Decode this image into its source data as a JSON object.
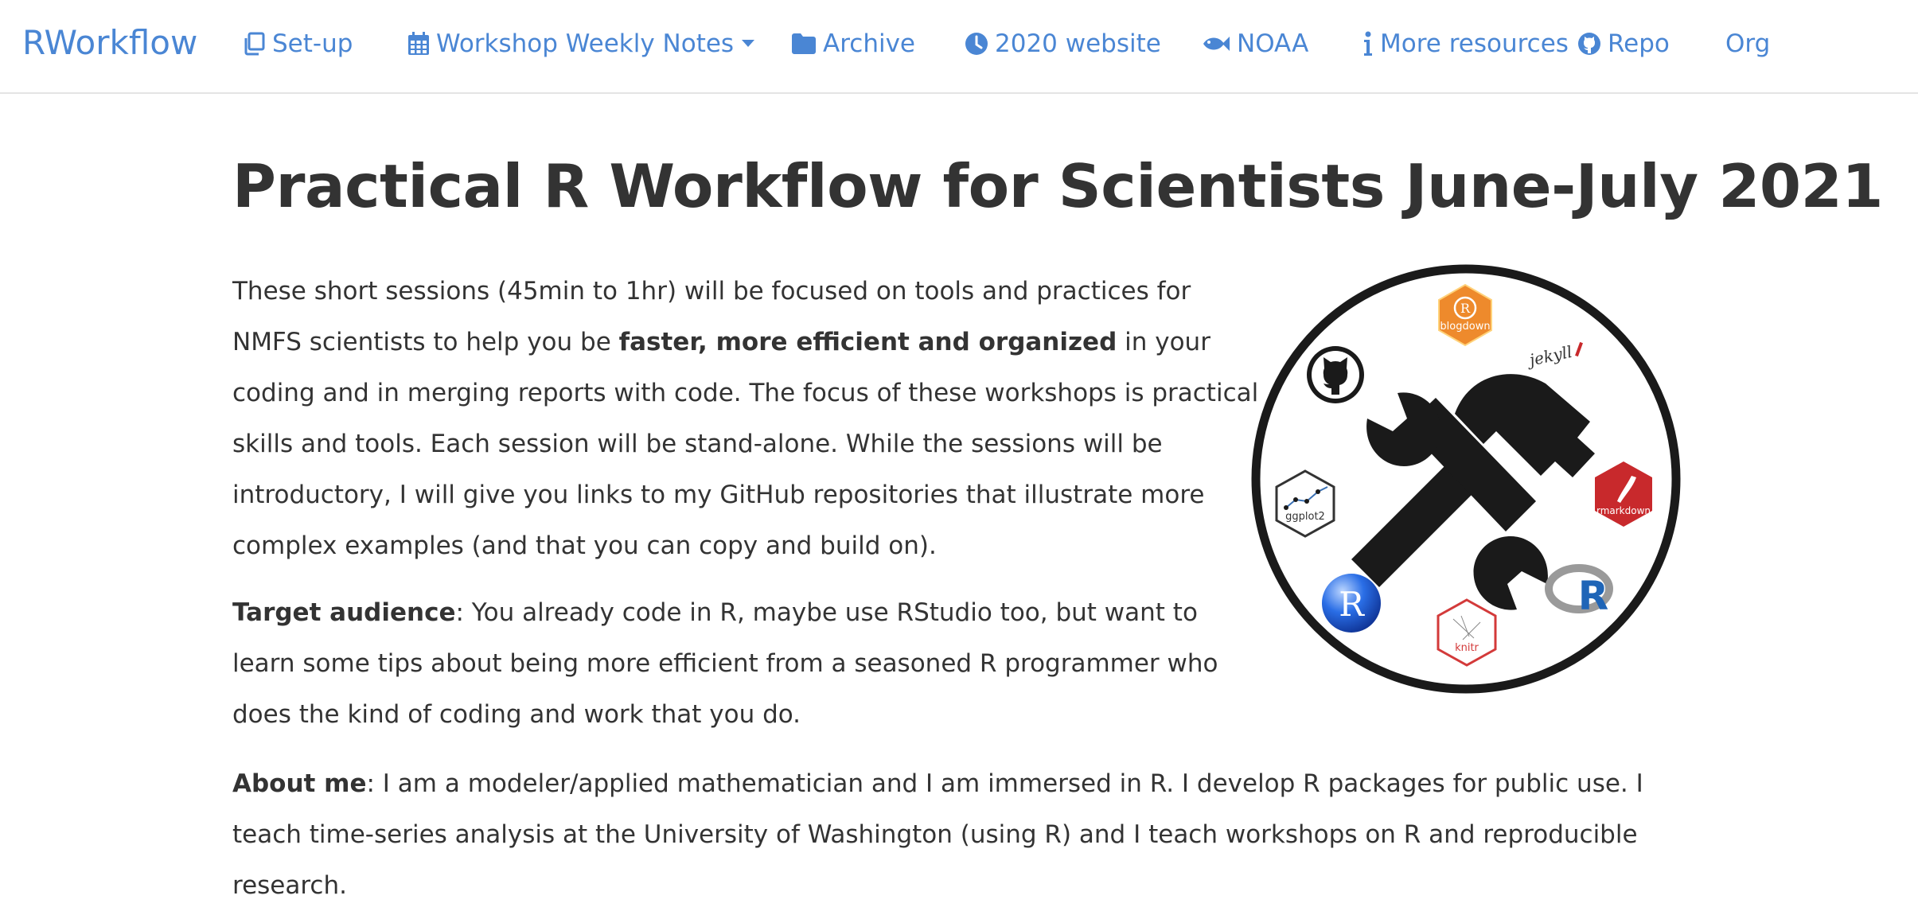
{
  "brand": "RWorkflow",
  "nav": {
    "setup": "Set-up",
    "weekly": "Workshop Weekly Notes",
    "archive": "Archive",
    "website": "2020 website",
    "noaa": "NOAA",
    "resources": "More resources",
    "repo": "Repo",
    "org": "Org"
  },
  "main": {
    "title": "Practical R Workflow for Scientists June-July 2021",
    "intro": {
      "part1": "These short sessions (45min to 1hr) will be focused on tools and practices for NMFS scientists to help you be ",
      "bold": "faster, more efficient and organized",
      "part2": " in your coding and in merging reports with code. The focus of these workshops is practical skills and tools. Each session will be stand-alone. While the sessions will be introductory, I will give you links to my GitHub repositories that illustrate more complex examples (and that you can copy and build on)."
    },
    "audience": {
      "label": "Target audience",
      "text": ": You already code in R, maybe use RStudio too, but want to learn some tips about being more efficient from a seasoned R programmer who does the kind of coding and work that you do."
    },
    "about": {
      "label": "About me",
      "text": ": I am a modeler/applied mathematician and I am immersed in R. I develop R packages for public use. I teach time-series analysis at the University of Washington (using R) and I teach workshops on R and reproducible research."
    }
  },
  "logo": {
    "blogdown": "blogdown",
    "jekyll": "jekyll",
    "rmarkdown": "rmarkdown",
    "ggplot2": "ggplot2",
    "knitr": "knitr",
    "r": "R"
  },
  "colors": {
    "link": "#4a86d4",
    "text": "#333333",
    "blogdown": "#ee8a2c",
    "rmarkdown": "#c8292c",
    "knitr": "#d33a3a",
    "rblue": "#1f65b7"
  }
}
